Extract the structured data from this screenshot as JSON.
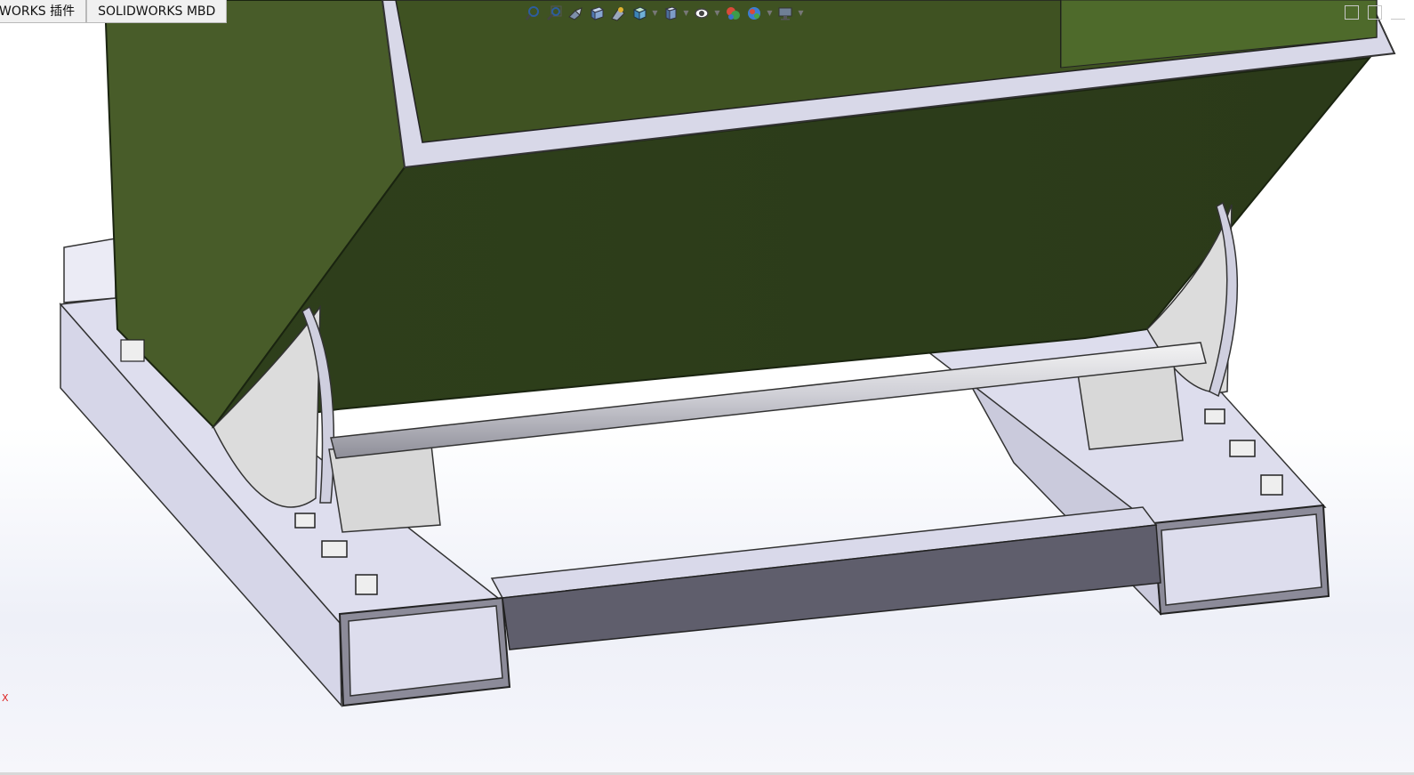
{
  "tabs": [
    {
      "label": "WORKS 插件"
    },
    {
      "label": "SOLIDWORKS MBD"
    }
  ],
  "heads_up_toolbar": [
    {
      "icon": "zoom-to-fit-icon"
    },
    {
      "icon": "zoom-to-area-icon"
    },
    {
      "icon": "previous-view-icon"
    },
    {
      "icon": "section-view-icon"
    },
    {
      "icon": "dynamic-annotation-icon"
    },
    {
      "icon": "view-orientation-icon"
    },
    {
      "icon": "display-style-icon"
    },
    {
      "icon": "hide-show-items-icon"
    },
    {
      "icon": "edit-appearance-icon"
    },
    {
      "icon": "apply-scene-icon"
    },
    {
      "icon": "view-settings-icon"
    }
  ],
  "axis_label": "X",
  "colors": {
    "body_green": "#33451f",
    "body_green_light": "#485c29",
    "steel": "#dcdcec",
    "steel_dark": "#5e5d6b"
  }
}
